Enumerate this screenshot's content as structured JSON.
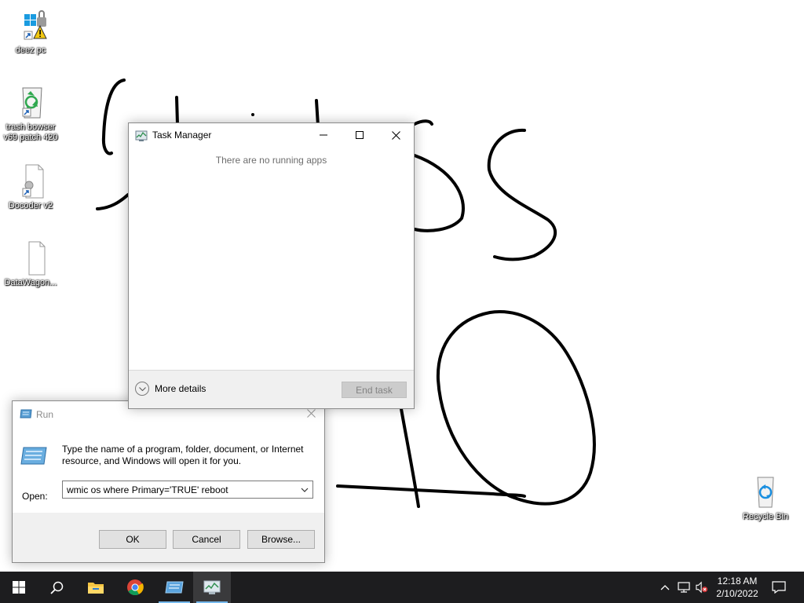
{
  "desktop": {
    "icons": [
      {
        "label": "deez pc"
      },
      {
        "label": "trash bowser v69 patch 420"
      },
      {
        "label": "Docoder v2"
      },
      {
        "label": "DataWagon..."
      },
      {
        "label": "Recycle Bin"
      }
    ],
    "drawing_color": "#000000",
    "background_color": "#ffffff"
  },
  "task_manager": {
    "title": "Task Manager",
    "empty_message": "There are no running apps",
    "more_details_label": "More details",
    "end_task_label": "End task",
    "end_task_enabled": false
  },
  "run_dialog": {
    "title": "Run",
    "description": "Type the name of a program, folder, document, or Internet resource, and Windows will open it for you.",
    "open_label": "Open:",
    "open_value": "wmic os where Primary='TRUE' reboot",
    "buttons": {
      "ok": "OK",
      "cancel": "Cancel",
      "browse": "Browse..."
    }
  },
  "taskbar": {
    "pinned": [
      {
        "icon": "start-icon"
      },
      {
        "icon": "search-icon"
      },
      {
        "icon": "file-explorer-icon"
      },
      {
        "icon": "chrome-icon"
      },
      {
        "icon": "run-app-icon",
        "active": true
      },
      {
        "icon": "task-manager-icon",
        "active": true
      }
    ],
    "tray": {
      "icons": [
        "chevron-up-icon",
        "network-icon",
        "volume-muted-icon"
      ]
    },
    "clock": {
      "time": "12:18 AM",
      "date": "2/10/2022"
    },
    "accent_color": "#76b9ed"
  }
}
